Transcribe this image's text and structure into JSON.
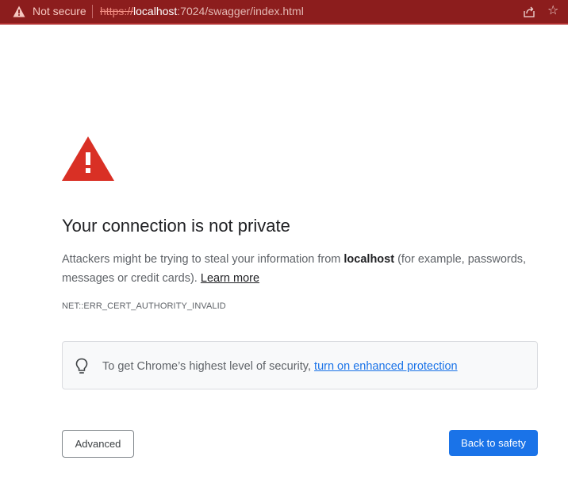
{
  "address_bar": {
    "security_label": "Not secure",
    "url_scheme": "https://",
    "url_host": "localhost",
    "url_path": ":7024/swagger/index.html",
    "icons": [
      "warning-icon",
      "share-icon",
      "star-icon"
    ]
  },
  "interstitial": {
    "heading": "Your connection is not private",
    "explanation_before": "Attackers might be trying to steal your information from ",
    "explanation_host": "localhost",
    "explanation_after": " (for example, passwords, messages or credit cards). ",
    "learn_more": "Learn more",
    "error_code": "NET::ERR_CERT_AUTHORITY_INVALID",
    "enhanced_text": "To get Chrome’s highest level of security, ",
    "enhanced_link": "turn on enhanced protection",
    "advanced_button": "Advanced",
    "back_button": "Back to safety"
  },
  "colors": {
    "bar_background": "#8c1d1d",
    "danger_red": "#d93025",
    "primary_blue": "#1a73e8"
  }
}
